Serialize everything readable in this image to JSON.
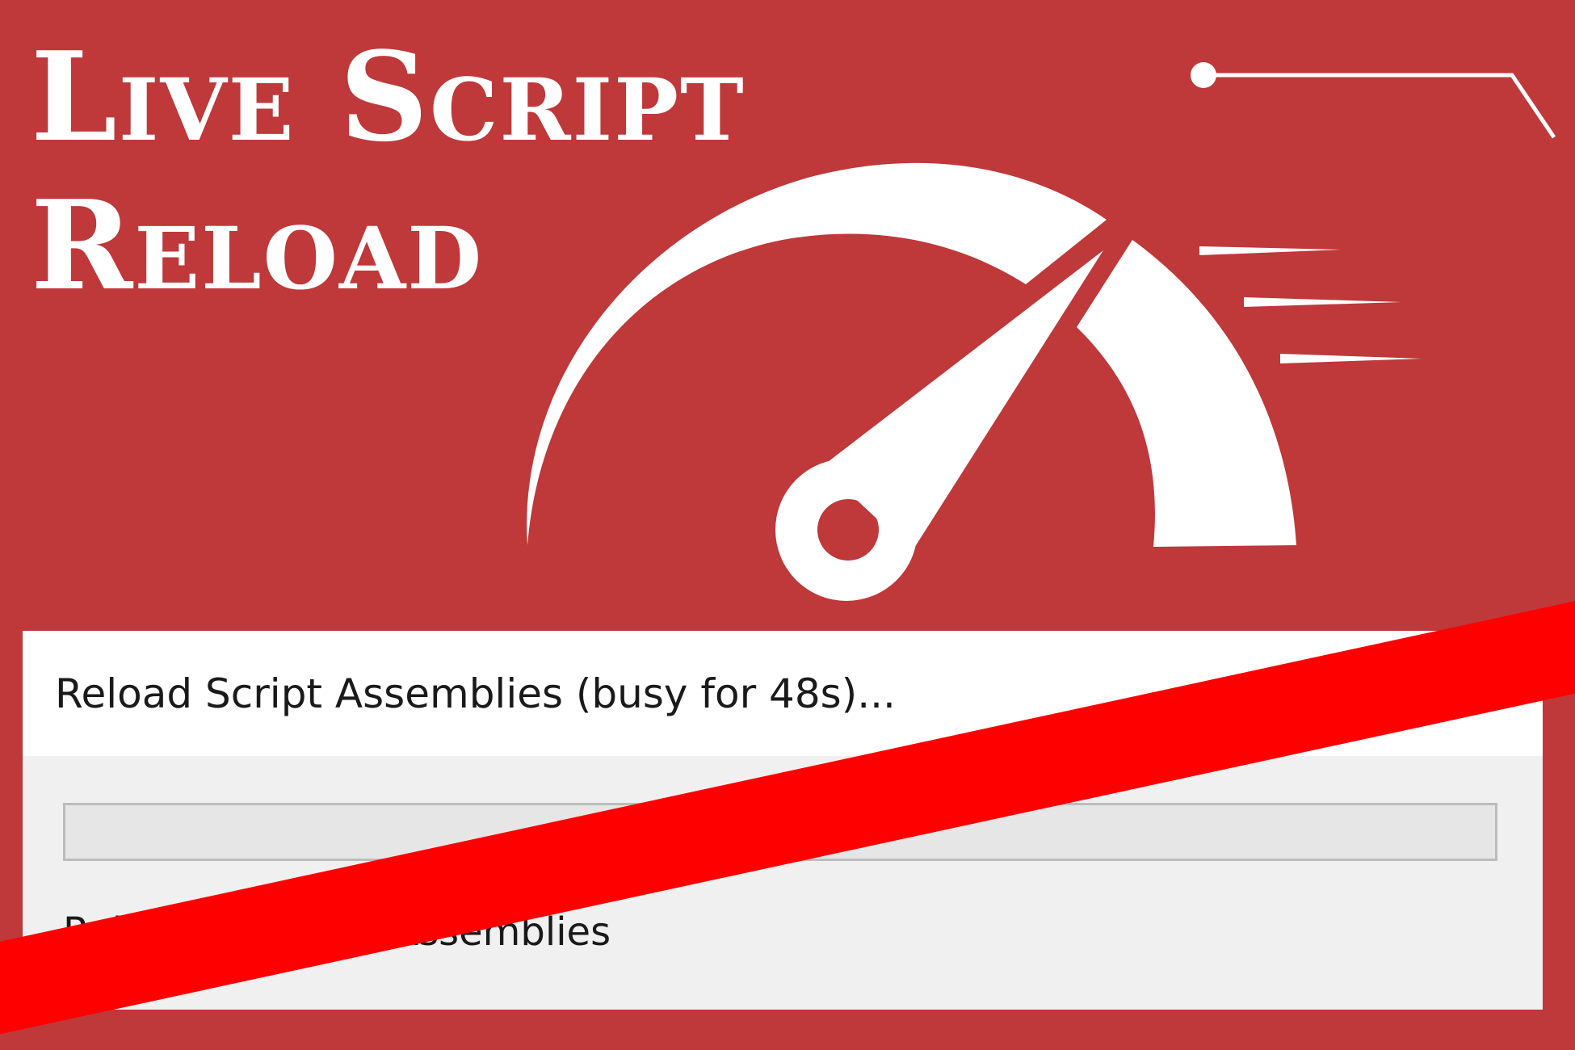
{
  "banner": {
    "title_line1": "Live Script",
    "title_line2": "Reload",
    "background_color": "#bf383a",
    "graphic_icon": "speedometer-icon",
    "graphic_color": "#ffffff"
  },
  "dialog": {
    "title": "Reload Script Assemblies (busy for 48s)...",
    "progress_fraction": 0,
    "status_text": "Reloading Script Assemblies"
  },
  "overlay": {
    "strike_color": "#ff0000",
    "strike_icon": "strike-through-bar"
  }
}
